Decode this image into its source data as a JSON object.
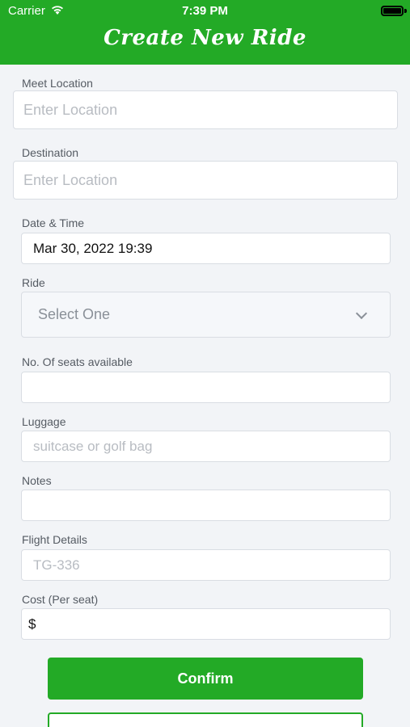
{
  "status": {
    "carrier": "Carrier",
    "time": "7:39 PM"
  },
  "header": {
    "title": "Create New Ride"
  },
  "form": {
    "meet_location": {
      "label": "Meet Location",
      "placeholder": "Enter Location"
    },
    "destination": {
      "label": "Destination",
      "placeholder": "Enter Location"
    },
    "date_time": {
      "label": "Date & Time",
      "value": "Mar 30, 2022 19:39"
    },
    "ride": {
      "label": "Ride",
      "selected": "Select One"
    },
    "seats": {
      "label": "No. Of seats available",
      "value": ""
    },
    "luggage": {
      "label": "Luggage",
      "placeholder": "suitcase or golf bag"
    },
    "notes": {
      "label": "Notes",
      "value": ""
    },
    "flight": {
      "label": "Flight Details",
      "placeholder": "TG-336"
    },
    "cost": {
      "label": "Cost (Per seat)",
      "value": "$"
    }
  },
  "buttons": {
    "confirm": "Confirm"
  },
  "colors": {
    "brand": "#23aa26",
    "background": "#f2f4f7"
  },
  "icons": [
    "wifi-icon",
    "battery-icon",
    "chevron-down-icon"
  ]
}
